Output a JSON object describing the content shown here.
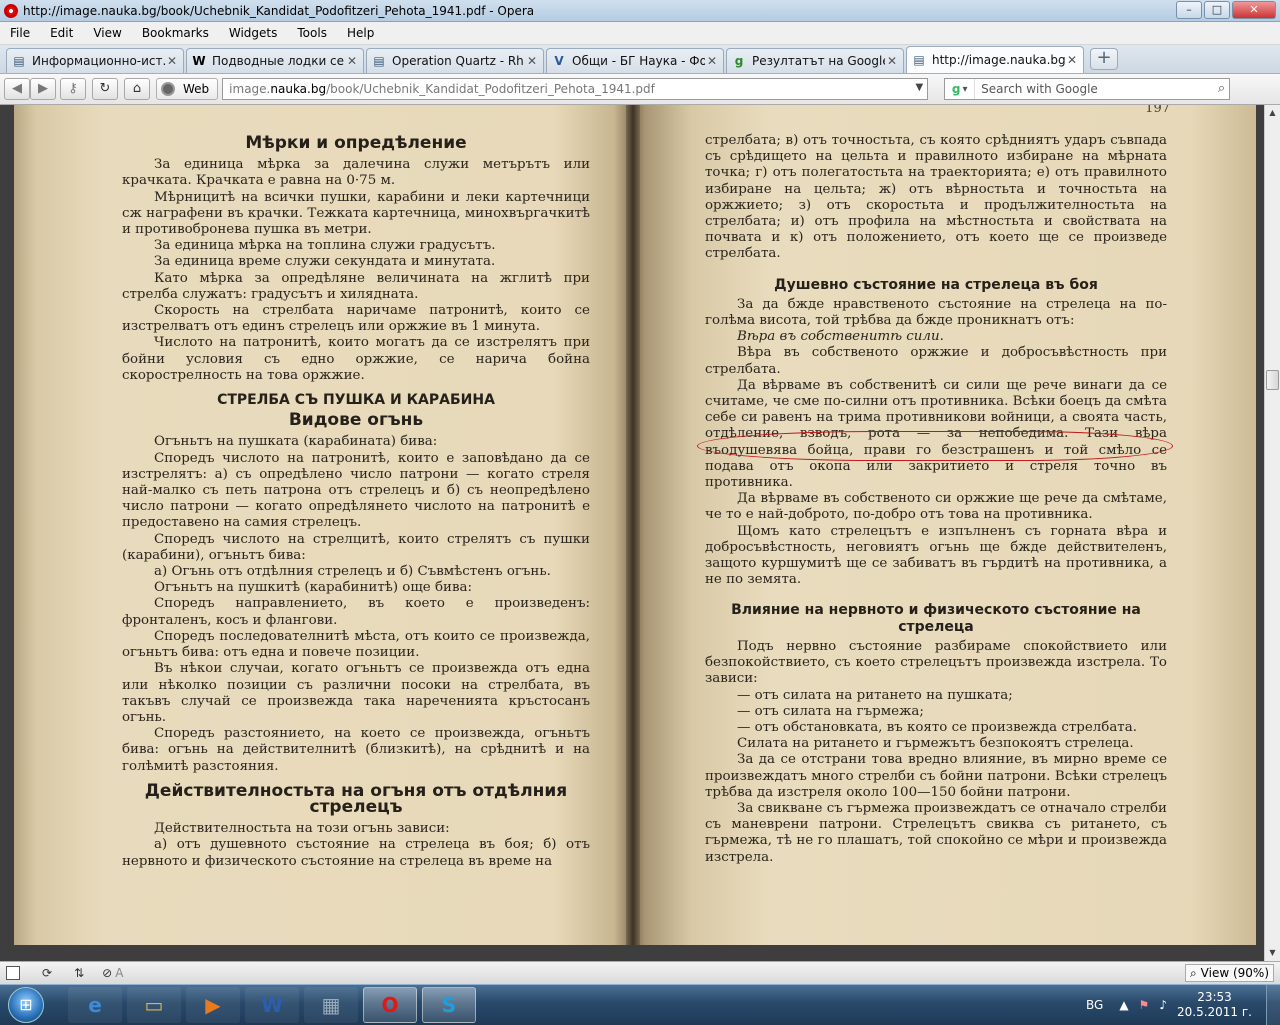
{
  "window": {
    "title": "http://image.nauka.bg/book/Uchebnik_Kandidat_Podofitzeri_Pehota_1941.pdf - Opera",
    "minimize": "–",
    "maximize": "□",
    "close": "✕"
  },
  "menu": [
    "File",
    "Edit",
    "View",
    "Bookmarks",
    "Widgets",
    "Tools",
    "Help"
  ],
  "tabs": [
    {
      "label": "Информационно-ист...",
      "icon": "page-icon",
      "fav": "▤",
      "color": "#3b5b7b"
    },
    {
      "label": "Подводные лодки сер...",
      "icon": "wikipedia-icon",
      "fav": "W",
      "color": "#000000"
    },
    {
      "label": "Operation Quartz - Rh...",
      "icon": "page-icon",
      "fav": "▤",
      "color": "#3b5b7b"
    },
    {
      "label": "Общи - БГ Наука - Фо...",
      "icon": "forum-icon",
      "fav": "V",
      "color": "#2a5a9a"
    },
    {
      "label": "Резултатът на Google ...",
      "icon": "google-icon",
      "fav": "g",
      "color": "#2f8a2f"
    },
    {
      "label": "http://image.nauka.bg...",
      "icon": "page-icon",
      "fav": "▤",
      "color": "#3b5b7b",
      "active": true
    }
  ],
  "tab_close": "✕",
  "new_tab": "+",
  "toolbar": {
    "back": "◀",
    "forward": "▶",
    "wand": "⚷",
    "reload": "↻",
    "home": "⌂",
    "web_label": "Web",
    "url_prefix": "image.",
    "url_host": "nauka.bg",
    "url_rest": "/book/Uchebnik_Kandidat_Podofitzeri_Pehota_1941.pdf",
    "url_dropdown": "▼",
    "search_engine": "g",
    "search_dropdown": "▾",
    "search_placeholder": "Search with Google",
    "search_icon": "⌕"
  },
  "left_page": {
    "h1": "Мѣрки и опредѣление",
    "p1": "За единица мѣрка за далечина служи метърътъ или крачката. Крачката е равна на 0·75 м.",
    "p2": "Мѣрницитѣ на всички пушки, карабини и леки картечници сж нагрaфени въ крачки. Тежката картечница, минохвъргачкитѣ и противобронева пушка въ метри.",
    "p3": "За единица мѣрка на топлина служи градусътъ.",
    "p4": "За единица време служи секундата и минутата.",
    "p5": "Като мѣрка за опредѣляне величината на жглитѣ при стрелба служатъ: градусътъ и хилядната.",
    "p6": "Скорость на стрелбата наричаме патронитѣ, които се изстрелватъ отъ единъ стрелецъ или оржжие въ 1 минута.",
    "p7": "Числото на патронитѣ, които могатъ да се изстрелятъ при бойни условия съ едно оржжие, се нарича бойна скорострелность на това оржжие.",
    "h2": "СТРЕЛБА СЪ ПУШКА И КАРАБИНА",
    "h3": "Видове огънь",
    "p8": "Огъньтъ на пушката (карабината) бива:",
    "p9": "Споредъ числото на патронитѣ, които е заповѣдано да се изстрелятъ: а) съ опредѣлено число патрони — когато стреля най-малко съ петь патрона отъ стрелецъ и б) съ неопредѣлено число патрони — когато опредѣлянето числото на патронитѣ е предоставено на самия стрелецъ.",
    "p10": "Споредъ числото на стрелцитѣ, които стрелятъ съ пушки (карабини), огъньтъ бива:",
    "p11": "а) Огънь отъ отдѣлния стрелецъ и б) Съвмѣстенъ огънь.",
    "p12": "Огъньтъ на пушкитѣ (карабинитѣ) още бива:",
    "p13": "Споредъ направлението, въ което е произведенъ: фронталенъ, косъ и флангови.",
    "p14": "Споредъ последователнитѣ мѣста, отъ които се произвежда, огъньтъ бива: отъ една и повече позиции.",
    "p15": "Въ нѣкои случаи, когато огъньтъ се произвежда отъ една или нѣколко позиции съ различни посоки на стрелбата, въ такъвъ случай се произвежда така нареченията кръстосанъ огънь.",
    "p16": "Споредъ разстоянието, на което се произвежда, огъньтъ бива: огънь на действителнитѣ (близкитѣ), на срѣднитѣ и на голѣмитѣ разстояния.",
    "h4": "Действителностьта на огъня отъ отдѣлния стрелецъ",
    "p17": "Действителностьта на този огънь зависи:",
    "p18": "а) отъ душевното състояние на стрелеца въ боя; б) отъ нервното и физическото състояние на стрелеца въ време на"
  },
  "right_page": {
    "page_number": "197",
    "p1": "стрелбата; в) отъ точностьта, съ която срѣдниятъ ударъ съвпада съ срѣдището на цельта и правилното избиране на мѣрната точка; г) отъ полегатостьта на траекторията; е) отъ правилното избиране на цельта; ж) отъ вѣрностьта и точностьта на оржжието; з) отъ скоростьта и продължителностьта на стрелбата; и) отъ профила на мѣстностьта и свойствата на почвата и к) отъ положението, отъ което ще се произведе стрелбата.",
    "h1": "Душевно състояние на стрелеца въ боя",
    "p2": "За да бжде нравственото състояние на стрелеца на по-голѣма висота, той трѣбва да бжде проникнатъ отъ:",
    "p3": "Вѣра въ собственитѣ сили.",
    "p4": "Вѣра въ собственото оржжие и добросъвѣстность при стрелбата.",
    "p5": "Да вѣрваме въ собственитѣ си сили ще рече винаги да се считаме, че сме по-силни отъ противника. Всѣки боецъ да смѣта себе си равенъ на трима противникови войници, а своята часть, отдѣление, взводъ, рота — за непобедима. Тази вѣра въодушевява бойца, прави го безстрашенъ и той смѣло се подава отъ окопа или закритието и стреля точно въ противника.",
    "p6": "Да вѣрваме въ собственото си оржжие ще рече да смѣтаме, че то е най-доброто, по-добро отъ това на противника.",
    "p7": "Щомъ като стрелецътъ е изпълненъ съ горната вѣра и добросъвѣстность, неговиятъ огънь ще бжде действителенъ, защото куршумитѣ ще се забиватъ въ гърдитѣ на противника, а не по земята.",
    "h2": "Влияние на нервното и физическото състояние на стрелеца",
    "p8": "Подъ нервно състояние разбираме спокойствието или безпокойствието, съ което стрелецътъ произвежда изстрела. То зависи:",
    "p9": "— отъ силата на ритането на пушката;",
    "p10": "— отъ силата на гърмежа;",
    "p11": "— отъ обстановката, въ която се произвежда стрелбата.",
    "p12": "Силата на ритането и гърмежътъ безпокоятъ стрелеца.",
    "p13": "За да се отстрани това вредно влияние, въ мирно време се произвеждатъ много стрелби съ бойни патрони. Всѣки стрелецъ трѣбва да изстреля около 100—150 бойни патрони.",
    "p14": "За свикване съ гърмежа произвеждатъ се отначало стрелби съ маневрени патрони. Стрелецътъ свиква съ ритането, съ гърмежа, тѣ не го плашатъ, той спокойно се мѣри и произвежда изстрела."
  },
  "scrollbar": {
    "up": "▲",
    "down": "▼"
  },
  "status": {
    "zoom_label": "View (90%)",
    "zoom_icon": "⌕",
    "sync": "⟳",
    "share": "⇅",
    "block": "⊘",
    "text_a": "A"
  },
  "taskbar": {
    "start": "⊞",
    "apps": [
      {
        "name": "ie-taskbar-button",
        "glyph": "e",
        "color": "#3b8bd8"
      },
      {
        "name": "explorer-taskbar-button",
        "glyph": "▭",
        "color": "#e2b24a"
      },
      {
        "name": "media-player-taskbar-button",
        "glyph": "▶",
        "color": "#e87a20"
      },
      {
        "name": "word-taskbar-button",
        "glyph": "W",
        "color": "#2b5fae"
      },
      {
        "name": "calculator-taskbar-button",
        "glyph": "▦",
        "color": "#9ab"
      },
      {
        "name": "opera-taskbar-button",
        "glyph": "O",
        "color": "#e01818"
      },
      {
        "name": "skype-taskbar-button",
        "glyph": "S",
        "color": "#1aa0e0"
      }
    ],
    "lang": "BG",
    "tray_up": "▲",
    "tray_flag": "⚑",
    "tray_volume": "♪",
    "time": "23:53",
    "date": "20.5.2011 г."
  }
}
